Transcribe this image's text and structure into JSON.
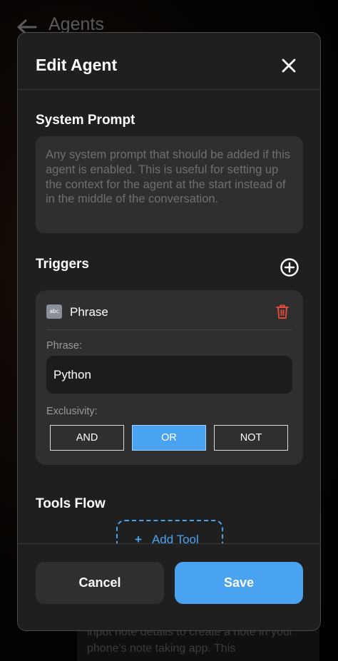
{
  "background": {
    "title": "Agents",
    "note_text": "input note details to create a note in your phone's note taking app. This"
  },
  "modal": {
    "title": "Edit Agent",
    "system_prompt": {
      "label": "System Prompt",
      "placeholder": "Any system prompt that should be added if this agent is enabled. This is useful for setting up the context for the agent at the start instead of in the middle of the conversation."
    },
    "triggers": {
      "label": "Triggers",
      "items": [
        {
          "icon_text": "abc",
          "type": "Phrase",
          "phrase_label": "Phrase:",
          "phrase_value": "Python",
          "exclusivity_label": "Exclusivity:",
          "options": [
            "AND",
            "OR",
            "NOT"
          ],
          "selected": "OR"
        }
      ]
    },
    "tools_flow": {
      "label": "Tools Flow",
      "add_tool_label": "Add Tool"
    },
    "footer": {
      "cancel_label": "Cancel",
      "save_label": "Save"
    }
  },
  "colors": {
    "accent": "#4aa3f0",
    "modal_bg": "#1f1f1f",
    "field_bg": "#2f2f2f",
    "danger": "#e24b3b"
  },
  "icons": [
    "back-arrow-icon",
    "close-icon",
    "add-circle-icon",
    "abc-icon",
    "trash-icon",
    "plus-icon"
  ]
}
